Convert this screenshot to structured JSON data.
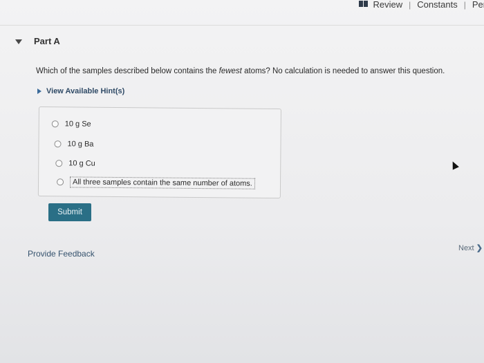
{
  "header": {
    "review_label": "Review",
    "separator": "|",
    "constants_label": "Constants",
    "periodic_label": "Peri"
  },
  "part": {
    "title": "Part A"
  },
  "question": {
    "text_before": "Which of the samples described below contains the ",
    "emphasis": "fewest",
    "text_after": " atoms? No calculation is needed to answer this question."
  },
  "hints": {
    "label": "View Available Hint(s)"
  },
  "answers": {
    "options": [
      {
        "label": "10 g Se",
        "selected": false
      },
      {
        "label": "10 g Ba",
        "selected": false
      },
      {
        "label": "10 g Cu",
        "selected": false
      },
      {
        "label": "All three samples contain the same number of atoms.",
        "selected": false
      }
    ]
  },
  "actions": {
    "submit_label": "Submit",
    "feedback_label": "Provide Feedback",
    "next_label": "Next",
    "next_chevron": "❯"
  }
}
